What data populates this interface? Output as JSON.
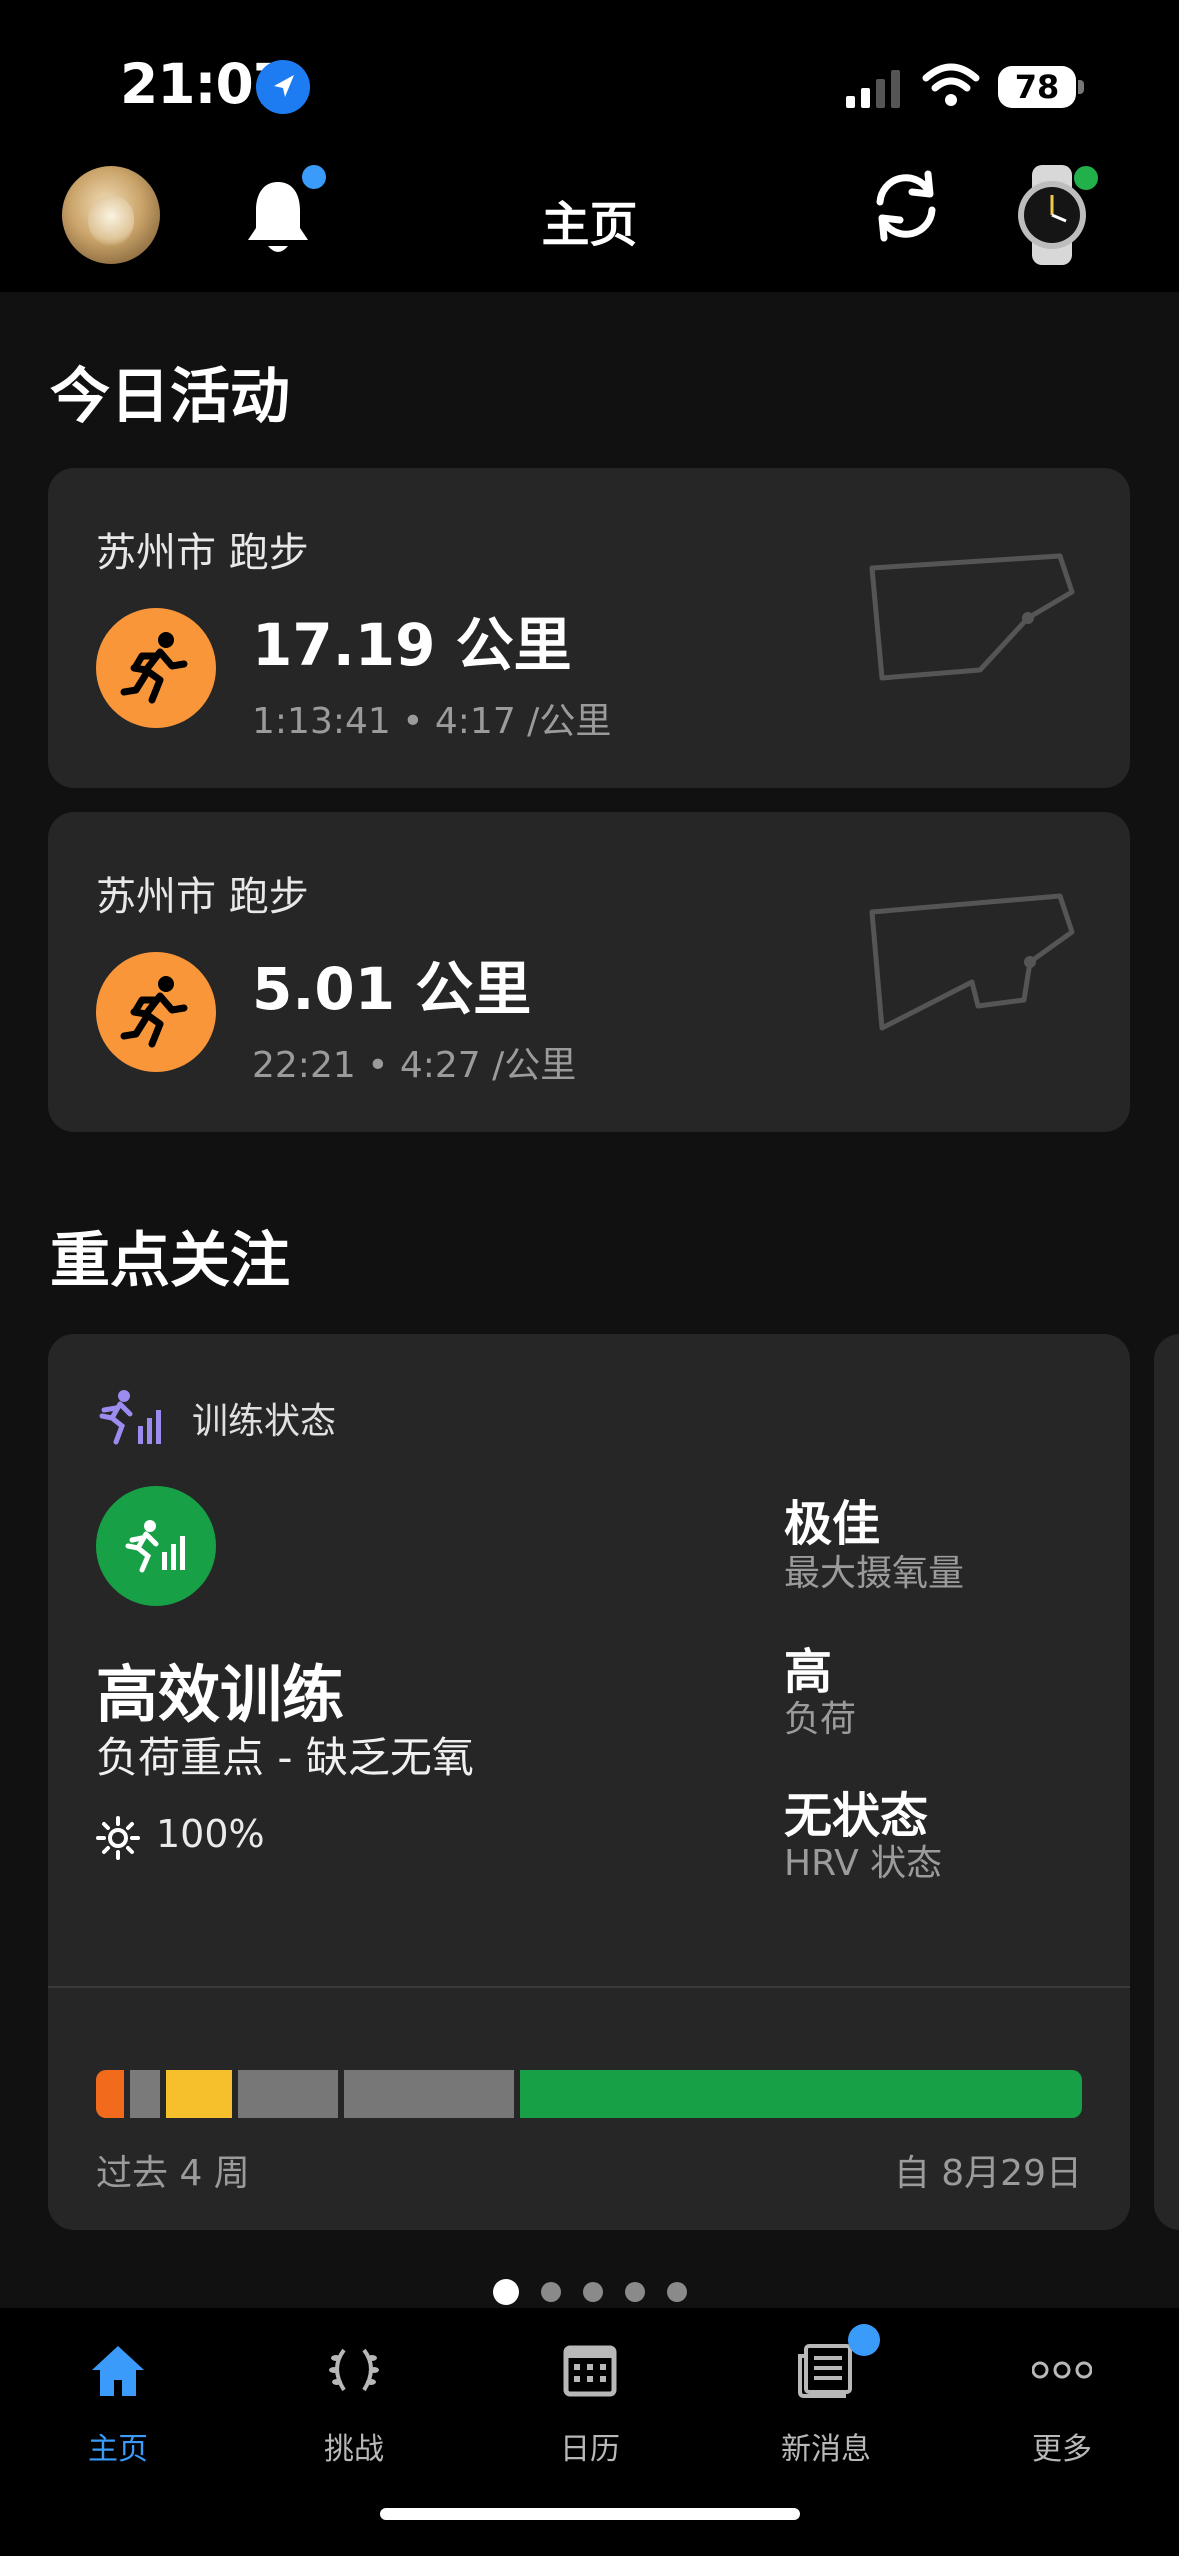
{
  "status_bar": {
    "time": "21:07",
    "battery": "78"
  },
  "header": {
    "title": "主页"
  },
  "today": {
    "heading": "今日活动",
    "activities": [
      {
        "location": "苏州市 跑步",
        "distance": "17.19 公里",
        "meta": "1:13:41 • 4:17 /公里"
      },
      {
        "location": "苏州市 跑步",
        "distance": "5.01 公里",
        "meta": "22:21 • 4:27 /公里"
      }
    ]
  },
  "focus": {
    "heading": "重点关注",
    "training": {
      "label": "训练状态",
      "status": "高效训练",
      "subtitle": "负荷重点 - 缺乏无氧",
      "percent": "100%",
      "metrics": [
        {
          "value": "极佳",
          "label": "最大摄氧量"
        },
        {
          "value": "高",
          "label": "负荷"
        },
        {
          "value": "无状态",
          "label": "HRV 状态"
        }
      ],
      "bar_colors": [
        "#f26b1d",
        "#7a7a7a",
        "#f5c02c",
        "#777777",
        "#777777",
        "#17a046"
      ],
      "past_label": "过去 4 周",
      "since_label": "自 8月29日"
    }
  },
  "pagination": {
    "count": 5,
    "active": 1
  },
  "tabs": [
    {
      "label": "主页",
      "icon": "home-icon",
      "active": true
    },
    {
      "label": "挑战",
      "icon": "laurel-icon",
      "active": false
    },
    {
      "label": "日历",
      "icon": "calendar-icon",
      "active": false
    },
    {
      "label": "新消息",
      "icon": "news-icon",
      "active": false
    },
    {
      "label": "更多",
      "icon": "more-icon",
      "active": false
    }
  ],
  "colors": {
    "accent": "#3a9bfb",
    "run": "#f9963a",
    "productive": "#17a046"
  }
}
